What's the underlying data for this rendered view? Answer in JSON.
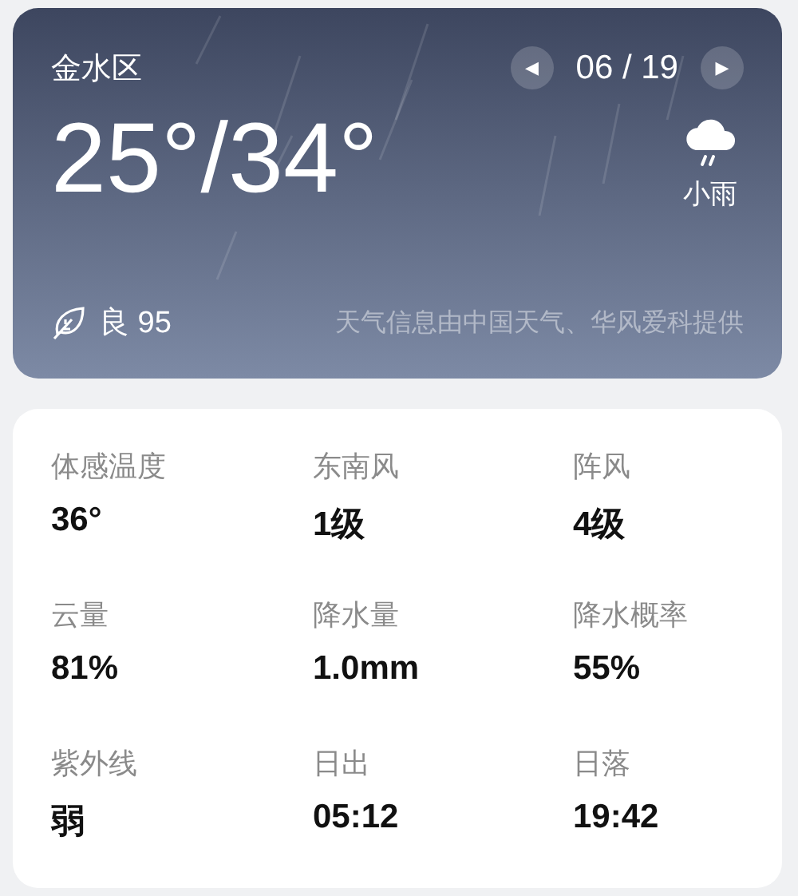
{
  "location": "金水区",
  "date_nav": {
    "prev": "◀",
    "date": "06 / 19",
    "next": "▶"
  },
  "temperature": "25°/34°",
  "condition": {
    "kind": "rain",
    "label": "小雨"
  },
  "air_quality": {
    "label": "良",
    "value": "95"
  },
  "attribution": "天气信息由中国天气、华风爱科提供",
  "details": [
    {
      "label": "体感温度",
      "value": "36°"
    },
    {
      "label": "东南风",
      "value": "1级"
    },
    {
      "label": "阵风",
      "value": "4级"
    },
    {
      "label": "云量",
      "value": "81%"
    },
    {
      "label": "降水量",
      "value": "1.0mm"
    },
    {
      "label": "降水概率",
      "value": "55%"
    },
    {
      "label": "紫外线",
      "value": "弱"
    },
    {
      "label": "日出",
      "value": "05:12"
    },
    {
      "label": "日落",
      "value": "19:42"
    }
  ]
}
